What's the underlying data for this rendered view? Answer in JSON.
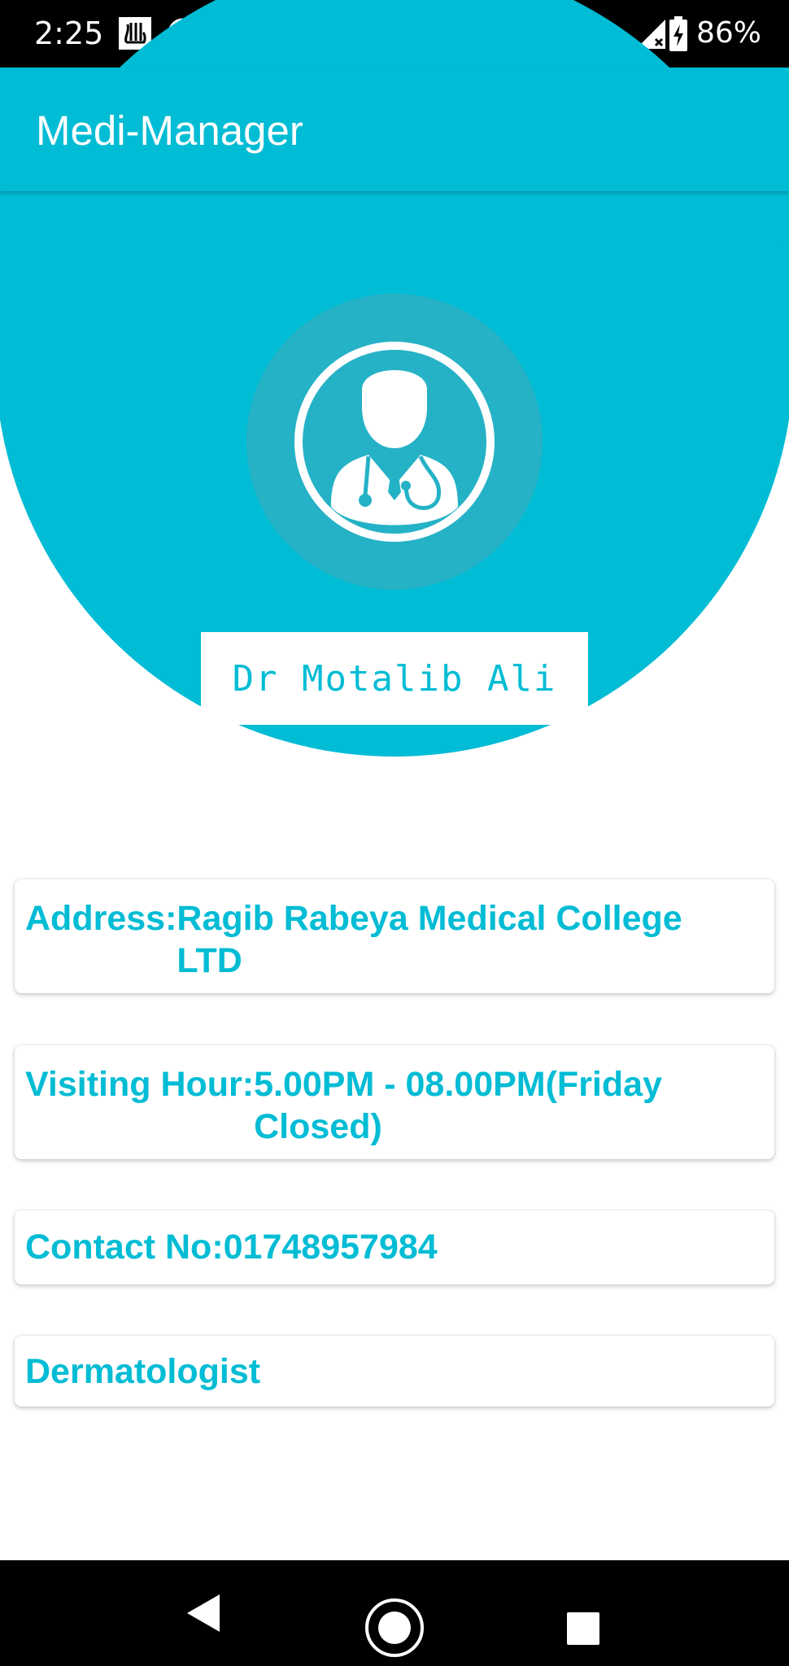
{
  "status_bar": {
    "time": "2:25",
    "battery_percent": "86%",
    "icons": [
      "allah-calligraphy-icon",
      "no-sync-icon",
      "notification-dot-icon",
      "signal-icon",
      "battery-icon"
    ]
  },
  "app_bar": {
    "title": "Medi-Manager"
  },
  "profile": {
    "avatar_icon": "doctor-avatar-icon",
    "name": "Dr Motalib Ali"
  },
  "details": {
    "address": {
      "label": "Address:",
      "value": "Ragib Rabeya Medical College LTD"
    },
    "visiting_hour": {
      "label": "Visiting Hour:",
      "value": "5.00PM - 08.00PM(Friday Closed)"
    },
    "contact": {
      "label": "Contact No:",
      "value": "01748957984"
    },
    "specialty": "Dermatologist"
  },
  "nav_bar": {
    "icons": [
      "back-icon",
      "home-icon",
      "recents-icon"
    ]
  },
  "colors": {
    "accent": "#00bcd4",
    "halo": "#25b2c6",
    "background": "#ffffff",
    "system_bars": "#000000"
  }
}
